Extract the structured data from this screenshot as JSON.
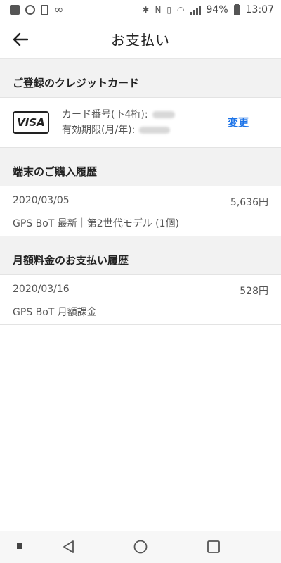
{
  "status_bar": {
    "battery": "94%",
    "time": "13:07"
  },
  "app_bar": {
    "title": "お支払い"
  },
  "card_section": {
    "header": "ご登録のクレジットカード",
    "brand": "VISA",
    "number_label": "カード番号(下4桁):",
    "expiry_label": "有効期限(月/年):",
    "change_label": "変更"
  },
  "device_section": {
    "header": "端末のご購入履歴",
    "items": [
      {
        "date": "2020/03/05",
        "amount": "5,636円",
        "description": "GPS BoT 最新｜第2世代モデル (1個)"
      }
    ]
  },
  "monthly_section": {
    "header": "月額料金のお支払い履歴",
    "items": [
      {
        "date": "2020/03/16",
        "amount": "528円",
        "description": "GPS BoT 月額課金"
      }
    ]
  },
  "colors": {
    "accent": "#1b73e8",
    "section_bg": "#f2f2f2"
  }
}
